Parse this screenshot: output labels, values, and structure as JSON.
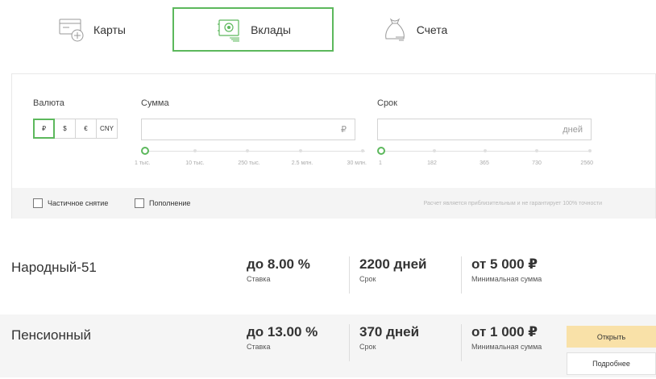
{
  "tabs": [
    {
      "label": "Карты",
      "icon": "card-add-icon",
      "active": false
    },
    {
      "label": "Вклады",
      "icon": "safe-icon",
      "active": true
    },
    {
      "label": "Счета",
      "icon": "money-bag-icon",
      "active": false
    }
  ],
  "filters": {
    "currency_label": "Валюта",
    "currencies": [
      "₽",
      "$",
      "€",
      "CNY"
    ],
    "selected_currency": "₽",
    "amount_label": "Сумма",
    "amount_suffix": "₽",
    "amount_ticks": [
      "1 тыс.",
      "10 тыс.",
      "250 тыс.",
      "2.5 млн.",
      "30 млн."
    ],
    "term_label": "Срок",
    "term_suffix": "дней",
    "term_ticks": [
      "1",
      "182",
      "365",
      "730",
      "2560"
    ],
    "partial_withdrawal_label": "Частичное снятие",
    "replenishment_label": "Пополнение",
    "disclaimer": "Расчет является приблизительным и не гарантирует 100% точности"
  },
  "deposits": [
    {
      "name": "Народный-51",
      "rate": "до 8.00 %",
      "rate_caption": "Ставка",
      "term": "2200 дней",
      "term_caption": "Срок",
      "min": "от 5 000 ₽",
      "min_caption": "Минимальная сумма"
    },
    {
      "name": "Пенсионный",
      "rate": "до 13.00 %",
      "rate_caption": "Ставка",
      "term": "370 дней",
      "term_caption": "Срок",
      "min": "от 1 000 ₽",
      "min_caption": "Минимальная сумма",
      "open_label": "Открыть",
      "more_label": "Подробнее"
    }
  ],
  "colors": {
    "accent": "#5cb85c",
    "open_button": "#f9e1a8"
  }
}
